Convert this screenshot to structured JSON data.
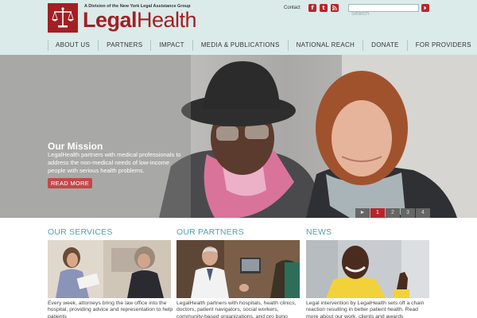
{
  "header": {
    "tagline": "A Division of the New York Legal Assistance Group",
    "logo_legal": "Legal",
    "logo_health": "Health",
    "contact_label": "Contact",
    "social": {
      "facebook": "f",
      "twitter": "t",
      "rss": "rss"
    },
    "search": {
      "placeholder": "Search",
      "value": ""
    }
  },
  "nav": {
    "items": [
      {
        "label": "ABOUT US"
      },
      {
        "label": "PARTNERS"
      },
      {
        "label": "IMPACT"
      },
      {
        "label": "MEDIA & PUBLICATIONS"
      },
      {
        "label": "NATIONAL REACH"
      },
      {
        "label": "DONATE"
      },
      {
        "label": "FOR PROVIDERS"
      }
    ]
  },
  "hero": {
    "title": "Our Mission",
    "text": "LegalHealth partners with medical professionals to address the non-medical needs of low-income people with serious health problems.",
    "button_label": "READ MORE",
    "slider": {
      "play": "►",
      "pages": [
        "1",
        "2",
        "3",
        "4"
      ],
      "active_page": "1"
    }
  },
  "columns": [
    {
      "title": "OUR SERVICES",
      "text": "Every week, attorneys bring the law office into the hospital, providing advice and representation to help patients"
    },
    {
      "title": "OUR PARTNERS",
      "text": "LegalHealth partners with hospitals, health clinics, doctors, patient navigators, social workers, community-based organizations, and pro bono"
    },
    {
      "title": "NEWS",
      "text": "Legal intervention by LegalHealth sets off a chain reaction resulting in better patient health. Read more about our work, clients and awards"
    }
  ],
  "colors": {
    "brand_red": "#a31f24",
    "header_bg": "#dbebea",
    "accent_teal": "#4fa3ad",
    "button_red": "#c4484a"
  }
}
